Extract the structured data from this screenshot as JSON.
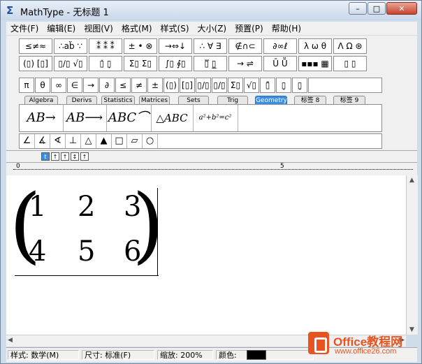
{
  "window": {
    "title": "MathType - 无标题 1",
    "buttons": [
      "–",
      "□",
      "✕"
    ]
  },
  "menubar": {
    "items": [
      "文件(F)",
      "编辑(E)",
      "视图(V)",
      "格式(M)",
      "样式(S)",
      "大小(Z)",
      "预置(P)",
      "帮助(H)"
    ]
  },
  "toolbar": {
    "row1": [
      "≤≠≈",
      "∴ab̈ ∵",
      "⁑ ⁑ ⁑",
      "± • ⊗",
      "→⇔↓",
      "∴ ∀ ∃",
      "∉∩⊂",
      "∂∞ℓ",
      "λ ω θ",
      "Λ Ω ⊛"
    ],
    "row2": [
      "(▯) [▯]",
      "▯∕▯ √▯",
      "▯̇ ▯̣",
      "Σ▯ Σ▯",
      "∫▯ ∮▯",
      "▯̅ ▯̲",
      "→ ⇌",
      "Ū Ṻ",
      "▪▪▪ ▦",
      "▯ ▯"
    ],
    "row3": [
      "π",
      "θ",
      "∞",
      "∈",
      "→",
      "∂",
      "≤",
      "≠",
      "±",
      "(▯)",
      "[▯]",
      "▯/▯",
      "▯/▯",
      "Σ▯",
      "√▯",
      "▯̄",
      "▯̣",
      "▯̣"
    ],
    "tabs": [
      "Algebra",
      "Derivs",
      "Statistics",
      "Matrices",
      "Sets",
      "Trig",
      "Geometry",
      "标签 8",
      "标签 9"
    ],
    "active_tab": "Geometry",
    "templates": [
      "AB→",
      "AB⟶",
      "ABC⌒",
      "△ABC",
      "a²+b²=c²"
    ],
    "geometry_symbols": [
      "∠",
      "∡",
      "∢",
      "⊥",
      "△",
      "▲",
      "□",
      "▱",
      "○"
    ]
  },
  "sizebar": {
    "buttons": [
      "t",
      "↑",
      "↑",
      "↕",
      "↑"
    ]
  },
  "ruler": {
    "marks": [
      "0",
      "5"
    ]
  },
  "matrix": {
    "rows": [
      [
        "1",
        "2",
        "3"
      ],
      [
        "4",
        "5",
        "6"
      ]
    ]
  },
  "statusbar": {
    "style": "样式: 数学(M)",
    "size": "尺寸: 标准(F)",
    "zoom": "缩放: 200%",
    "color_label": "颜色:",
    "color_value": "#000000"
  },
  "watermark": {
    "brand": "Office教程网",
    "url": "www.office26.com"
  },
  "colors": {
    "accent": "#3a8ee6",
    "brand": "#e8541f"
  }
}
